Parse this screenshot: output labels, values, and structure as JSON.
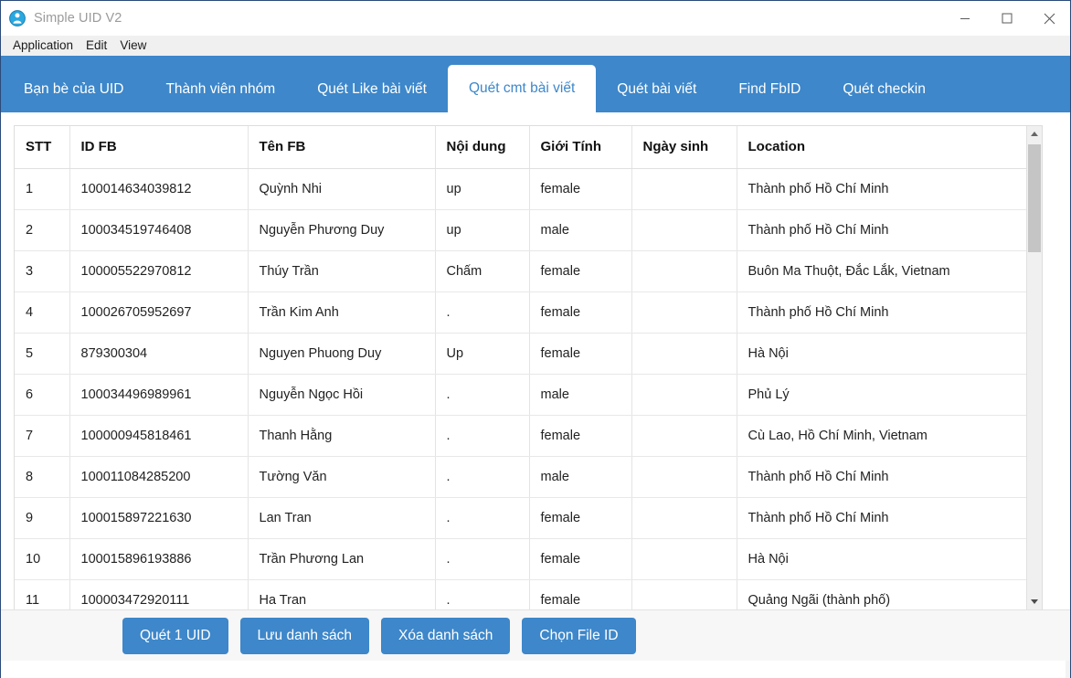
{
  "window": {
    "title": "Simple UID V2",
    "icon": "user-circle-icon",
    "minimize_label": "–",
    "maximize_label": "□",
    "close_label": "✕",
    "accent_color": "#3d87ca",
    "titlebar_text_color": "#9b9b9b"
  },
  "menubar": {
    "items": [
      {
        "label": "Application"
      },
      {
        "label": "Edit"
      },
      {
        "label": "View"
      }
    ]
  },
  "tabs": {
    "active_index": 3,
    "items": [
      {
        "label": "Bạn bè của UID"
      },
      {
        "label": "Thành viên nhóm"
      },
      {
        "label": "Quét Like bài viết"
      },
      {
        "label": "Quét cmt bài viết"
      },
      {
        "label": "Quét bài viết"
      },
      {
        "label": "Find FbID"
      },
      {
        "label": "Quét checkin"
      }
    ]
  },
  "table": {
    "columns": [
      "STT",
      "ID FB",
      "Tên FB",
      "Nội dung",
      "Giới Tính",
      "Ngày sinh",
      "Location"
    ],
    "rows": [
      [
        "1",
        "100014634039812",
        "Quỳnh Nhi",
        "up",
        "female",
        "",
        "Thành phố Hồ Chí Minh"
      ],
      [
        "2",
        "100034519746408",
        "Nguyễn Phương Duy",
        "up",
        "male",
        "",
        "Thành phố Hồ Chí Minh"
      ],
      [
        "3",
        "100005522970812",
        "Thúy Trần",
        "Chấm",
        "female",
        "",
        "Buôn Ma Thuột, Đắc Lắk, Vietnam"
      ],
      [
        "4",
        "100026705952697",
        "Trần Kim Anh",
        ".",
        "female",
        "",
        "Thành phố Hồ Chí Minh"
      ],
      [
        "5",
        "879300304",
        "Nguyen Phuong Duy",
        "Up",
        "female",
        "",
        "Hà Nội"
      ],
      [
        "6",
        "100034496989961",
        "Nguyễn Ngọc Hồi",
        ".",
        "male",
        "",
        "Phủ Lý"
      ],
      [
        "7",
        "100000945818461",
        "Thanh Hằng",
        ".",
        "female",
        "",
        "Cù Lao, Hồ Chí Minh, Vietnam"
      ],
      [
        "8",
        "100011084285200",
        "Tường Văn",
        ".",
        "male",
        "",
        "Thành phố Hồ Chí Minh"
      ],
      [
        "9",
        "100015897221630",
        "Lan Tran",
        ".",
        "female",
        "",
        "Thành phố Hồ Chí Minh"
      ],
      [
        "10",
        "100015896193886",
        "Trần Phương Lan",
        ".",
        "female",
        "",
        "Hà Nội"
      ],
      [
        "11",
        "100003472920111",
        "Ha Tran",
        ".",
        "female",
        "",
        "Quảng Ngãi (thành phố)"
      ]
    ]
  },
  "scrollbar": {
    "up_arrow": "scroll-up-arrow-icon",
    "down_arrow": "scroll-down-arrow-icon"
  },
  "buttons": [
    {
      "label": "Quét 1 UID"
    },
    {
      "label": "Lưu danh sách"
    },
    {
      "label": "Xóa danh sách"
    },
    {
      "label": "Chọn File ID"
    }
  ]
}
